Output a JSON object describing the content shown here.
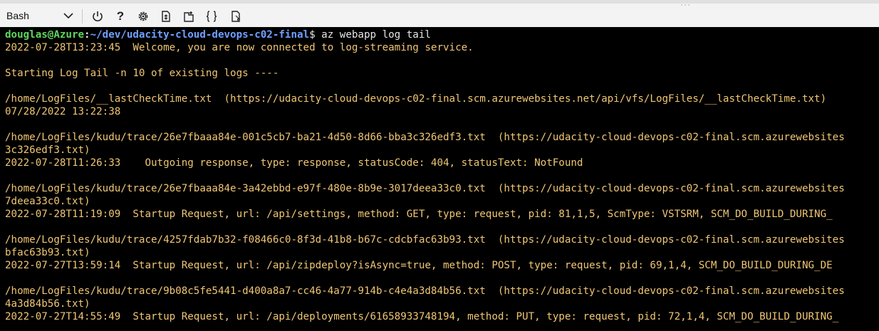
{
  "toolbar": {
    "shell": "Bash",
    "help_label": "?",
    "grip": "···",
    "icons": [
      "chevron-down-icon",
      "power-icon",
      "help-icon",
      "settings-icon",
      "upload-download-icon",
      "open-editor-icon",
      "braces-icon",
      "web-preview-icon"
    ]
  },
  "prompt": {
    "user_host": "douglas@Azure",
    "colon": ":",
    "path": "~/dev/udacity-cloud-devops-c02-final",
    "symbol": "$",
    "command": " az webapp log tail"
  },
  "lines": [
    "2022-07-28T13:23:45  Welcome, you are now connected to log-streaming service.",
    "",
    "Starting Log Tail -n 10 of existing logs ----",
    "",
    "/home/LogFiles/__lastCheckTime.txt  (https://udacity-cloud-devops-c02-final.scm.azurewebsites.net/api/vfs/LogFiles/__lastCheckTime.txt)",
    "07/28/2022 13:22:38",
    "",
    "/home/LogFiles/kudu/trace/26e7fbaaa84e-001c5cb7-ba21-4d50-8d66-bba3c326edf3.txt  (https://udacity-cloud-devops-c02-final.scm.azurewebsites",
    "3c326edf3.txt)",
    "2022-07-28T11:26:33    Outgoing response, type: response, statusCode: 404, statusText: NotFound",
    "",
    "/home/LogFiles/kudu/trace/26e7fbaaa84e-3a42ebbd-e97f-480e-8b9e-3017deea33c0.txt  (https://udacity-cloud-devops-c02-final.scm.azurewebsites",
    "7deea33c0.txt)",
    "2022-07-28T11:19:09  Startup Request, url: /api/settings, method: GET, type: request, pid: 81,1,5, ScmType: VSTSRM, SCM_DO_BUILD_DURING_",
    "",
    "/home/LogFiles/kudu/trace/4257fdab7b32-f08466c0-8f3d-41b8-b67c-cdcbfac63b93.txt  (https://udacity-cloud-devops-c02-final.scm.azurewebsites",
    "bfac63b93.txt)",
    "2022-07-27T13:59:14  Startup Request, url: /api/zipdeploy?isAsync=true, method: POST, type: request, pid: 69,1,4, SCM_DO_BUILD_DURING_DE",
    "",
    "/home/LogFiles/kudu/trace/9b08c5fe5441-d400a8a7-cc46-4a77-914b-c4e4a3d84b56.txt  (https://udacity-cloud-devops-c02-final.scm.azurewebsites",
    "4a3d84b56.txt)",
    "2022-07-27T14:55:49  Startup Request, url: /api/deployments/61658933748194, method: PUT, type: request, pid: 72,1,4, SCM_DO_BUILD_DURING_"
  ]
}
